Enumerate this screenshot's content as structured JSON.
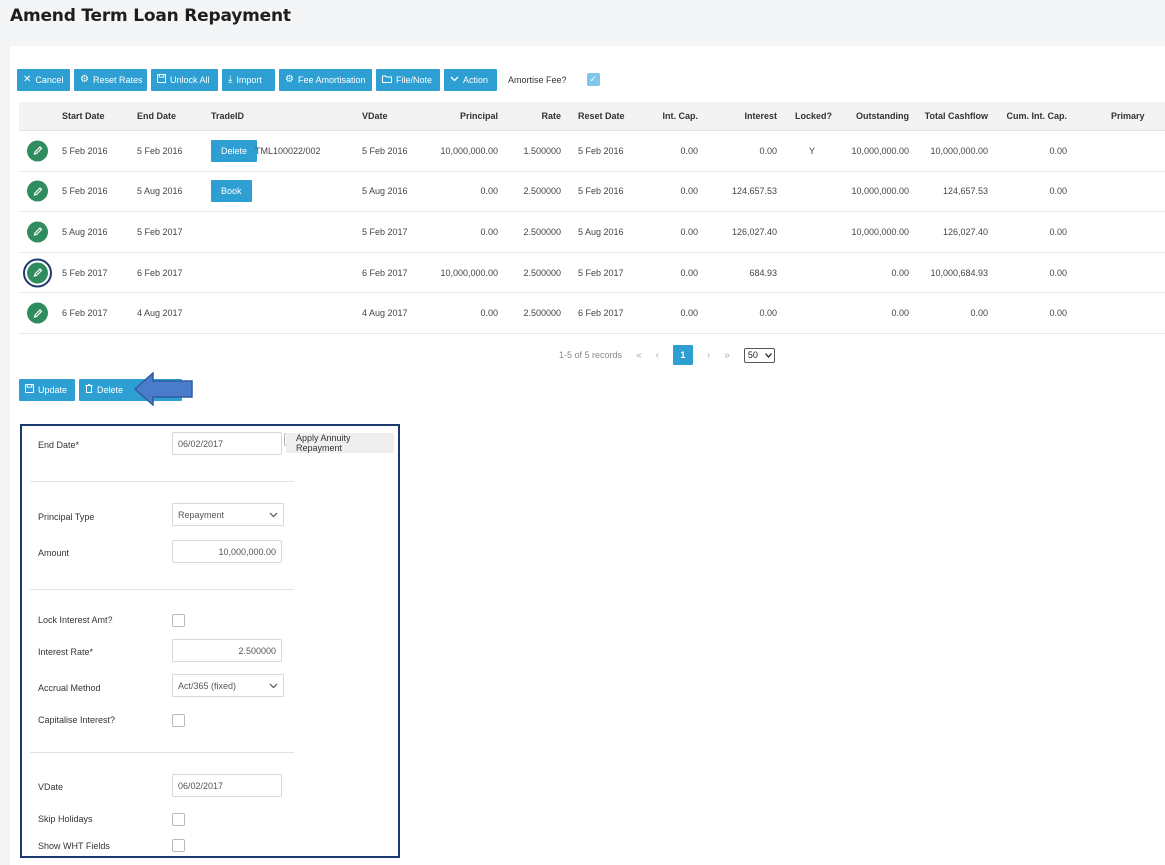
{
  "page": {
    "title": "Amend Term Loan Repayment"
  },
  "toolbar": {
    "buttons": [
      {
        "label": "Cancel",
        "icon": "close-icon"
      },
      {
        "label": "Reset Rates",
        "icon": "gear-icon"
      },
      {
        "label": "Unlock All",
        "icon": "save-icon"
      },
      {
        "label": "Import",
        "icon": "download-icon"
      },
      {
        "label": "Fee Amortisation",
        "icon": "gear-icon"
      },
      {
        "label": "File/Note",
        "icon": "folder-icon"
      },
      {
        "label": "Action",
        "icon": "chevron-down-icon"
      }
    ],
    "amortise_label": "Amortise Fee?",
    "amortise_checked": true
  },
  "grid": {
    "columns": [
      "Start Date",
      "End Date",
      "TradeID",
      "VDate",
      "Principal",
      "Rate",
      "Reset Date",
      "Int. Cap.",
      "Interest",
      "Locked?",
      "Outstanding",
      "Total Cashflow",
      "Cum. Int. Cap.",
      "Primary"
    ],
    "rows": [
      {
        "start": "5 Feb 2016",
        "end": "5 Feb 2016",
        "button": "Delete",
        "trade_id": "TML100022/002",
        "vdate": "5 Feb 2016",
        "principal": "10,000,000.00",
        "rate": "1.500000",
        "reset": "5 Feb 2016",
        "int_cap": "0.00",
        "interest": "0.00",
        "locked": "Y",
        "outstanding": "10,000,000.00",
        "total_cashflow": "10,000,000.00",
        "cum_int_cap": "0.00",
        "selected": false
      },
      {
        "start": "5 Feb 2016",
        "end": "5 Aug 2016",
        "button": "Book",
        "trade_id": "",
        "vdate": "5 Aug 2016",
        "principal": "0.00",
        "rate": "2.500000",
        "reset": "5 Feb 2016",
        "int_cap": "0.00",
        "interest": "124,657.53",
        "locked": "",
        "outstanding": "10,000,000.00",
        "total_cashflow": "124,657.53",
        "cum_int_cap": "0.00",
        "selected": false
      },
      {
        "start": "5 Aug 2016",
        "end": "5 Feb 2017",
        "button": "",
        "trade_id": "",
        "vdate": "5 Feb 2017",
        "principal": "0.00",
        "rate": "2.500000",
        "reset": "5 Aug 2016",
        "int_cap": "0.00",
        "interest": "126,027.40",
        "locked": "",
        "outstanding": "10,000,000.00",
        "total_cashflow": "126,027.40",
        "cum_int_cap": "0.00",
        "selected": false
      },
      {
        "start": "5 Feb 2017",
        "end": "6 Feb 2017",
        "button": "",
        "trade_id": "",
        "vdate": "6 Feb 2017",
        "principal": "10,000,000.00",
        "rate": "2.500000",
        "reset": "5 Feb 2017",
        "int_cap": "0.00",
        "interest": "684.93",
        "locked": "",
        "outstanding": "0.00",
        "total_cashflow": "10,000,684.93",
        "cum_int_cap": "0.00",
        "selected": true
      },
      {
        "start": "6 Feb 2017",
        "end": "4 Aug 2017",
        "button": "",
        "trade_id": "",
        "vdate": "4 Aug 2017",
        "principal": "0.00",
        "rate": "2.500000",
        "reset": "6 Feb 2017",
        "int_cap": "0.00",
        "interest": "0.00",
        "locked": "",
        "outstanding": "0.00",
        "total_cashflow": "0.00",
        "cum_int_cap": "0.00",
        "selected": false
      }
    ]
  },
  "pager": {
    "summary": "1-5 of 5 records",
    "first": "«",
    "prev": "‹",
    "current_page": "1",
    "next": "›",
    "last": "»",
    "page_size": "50"
  },
  "actions": {
    "update_label": "Update",
    "delete_label": "Delete"
  },
  "form": {
    "end_date_label": "End Date*",
    "end_date_value": "06/02/2017",
    "annuity_label": "Apply Annuity Repayment",
    "principal_type_label": "Principal Type",
    "principal_type_value": "Repayment",
    "amount_label": "Amount",
    "amount_value": "10,000,000.00",
    "lock_interest_label": "Lock Interest Amt?",
    "interest_rate_label": "Interest Rate*",
    "interest_rate_value": "2.500000",
    "accrual_label": "Accrual Method",
    "accrual_value": "Act/365 (fixed)",
    "capitalise_label": "Capitalise Interest?",
    "vdate_label": "VDate",
    "vdate_value": "06/02/2017",
    "skip_holidays_label": "Skip Holidays",
    "show_wht_label": "Show WHT Fields"
  },
  "colors": {
    "button_blue": "#2e9fd2",
    "edit_green": "#2f8c5e",
    "highlight_navy": "#1d3a6e",
    "arrow_blue": "#4a7cc9"
  }
}
